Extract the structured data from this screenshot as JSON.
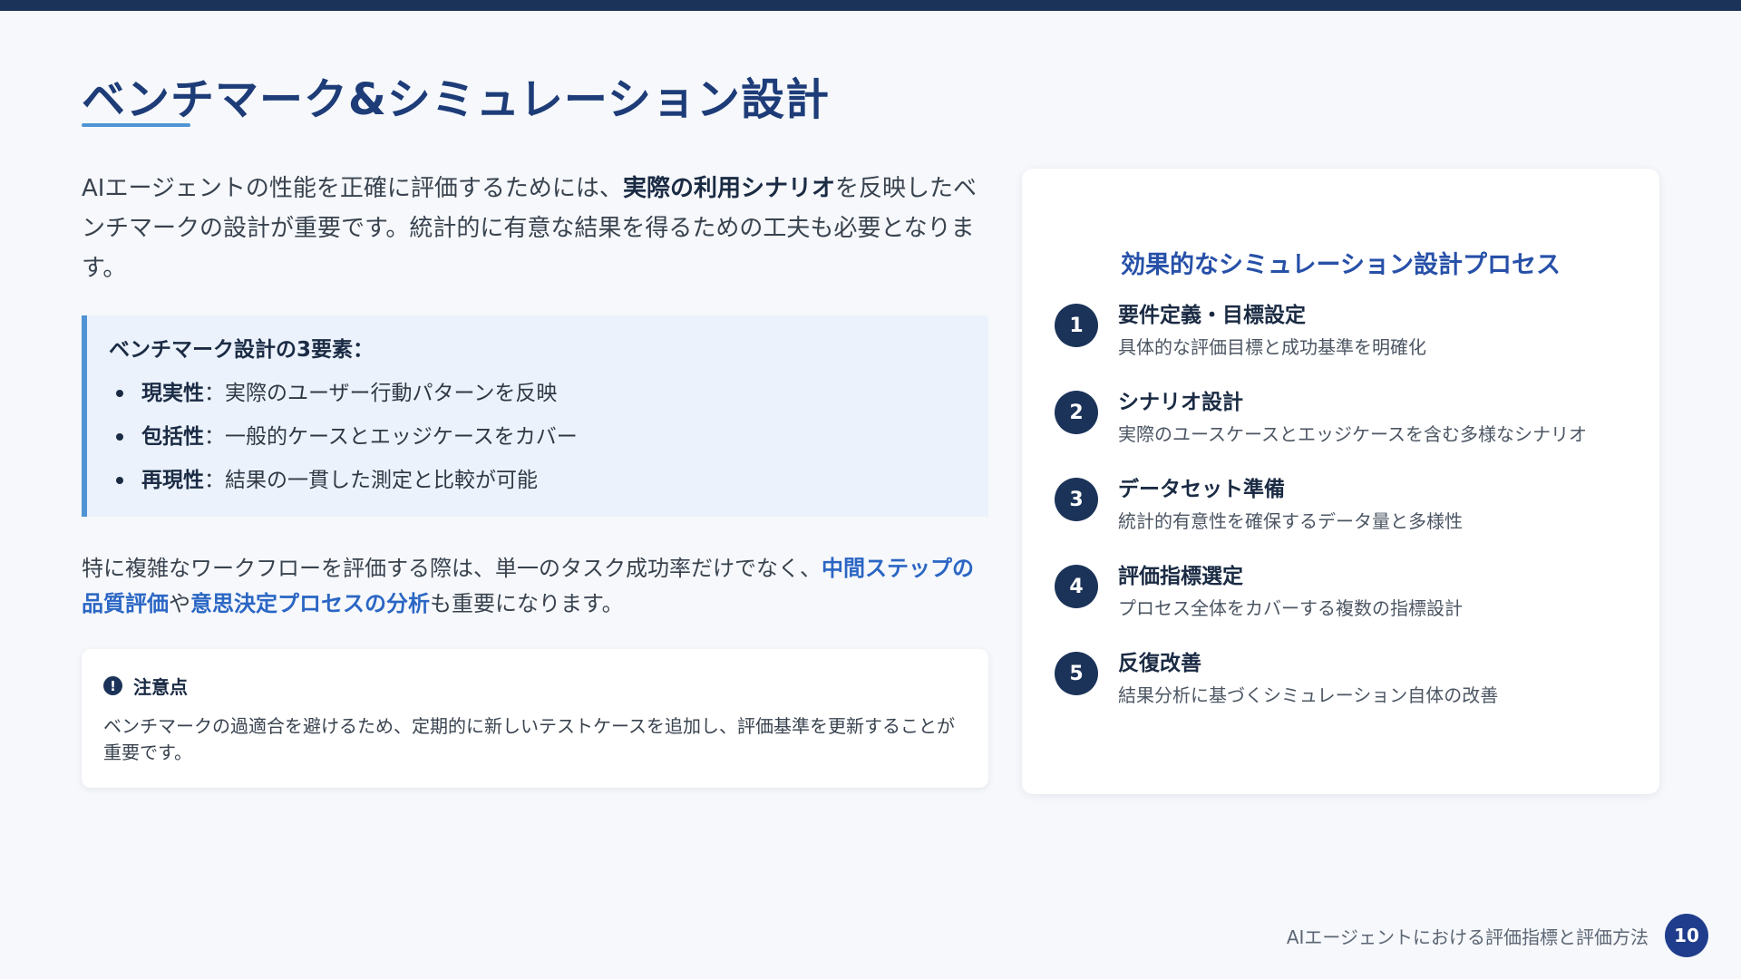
{
  "slide": {
    "title": "ベンチマーク&シミュレーション設計",
    "intro": {
      "prefix": "AIエージェントの性能を正確に評価するためには、",
      "emphasis": "実際の利用シナリオ",
      "suffix": "を反映したベンチマークの設計が重要です。統計的に有意な結果を得るための工夫も必要となります。"
    },
    "elements": {
      "title": "ベンチマーク設計の3要素：",
      "items": [
        {
          "label": "現実性",
          "text": "：実際のユーザー行動パターンを反映"
        },
        {
          "label": "包括性",
          "text": "：一般的ケースとエッジケースをカバー"
        },
        {
          "label": "再現性",
          "text": "：結果の一貫した測定と比較が可能"
        }
      ]
    },
    "extra": {
      "prefix": "特に複雑なワークフローを評価する際は、単一のタスク成功率だけでなく、",
      "link1": "中間ステップの品質評価",
      "middle": "や",
      "link2": "意思決定プロセスの分析",
      "suffix": "も重要になります。"
    },
    "note": {
      "icon": "!",
      "title": "注意点",
      "body": "ベンチマークの過適合を避けるため、定期的に新しいテストケースを追加し、評価基準を更新することが重要です。"
    },
    "process": {
      "title": "効果的なシミュレーション設計プロセス",
      "steps": [
        {
          "num": "1",
          "title": "要件定義・目標設定",
          "desc": "具体的な評価目標と成功基準を明確化"
        },
        {
          "num": "2",
          "title": "シナリオ設計",
          "desc": "実際のユースケースとエッジケースを含む多様なシナリオ"
        },
        {
          "num": "3",
          "title": "データセット準備",
          "desc": "統計的有意性を確保するデータ量と多様性"
        },
        {
          "num": "4",
          "title": "評価指標選定",
          "desc": "プロセス全体をカバーする複数の指標設計"
        },
        {
          "num": "5",
          "title": "反復改善",
          "desc": "結果分析に基づくシミュレーション自体の改善"
        }
      ]
    },
    "footer": {
      "text": "AIエージェントにおける評価指標と評価方法",
      "page": "10"
    }
  }
}
